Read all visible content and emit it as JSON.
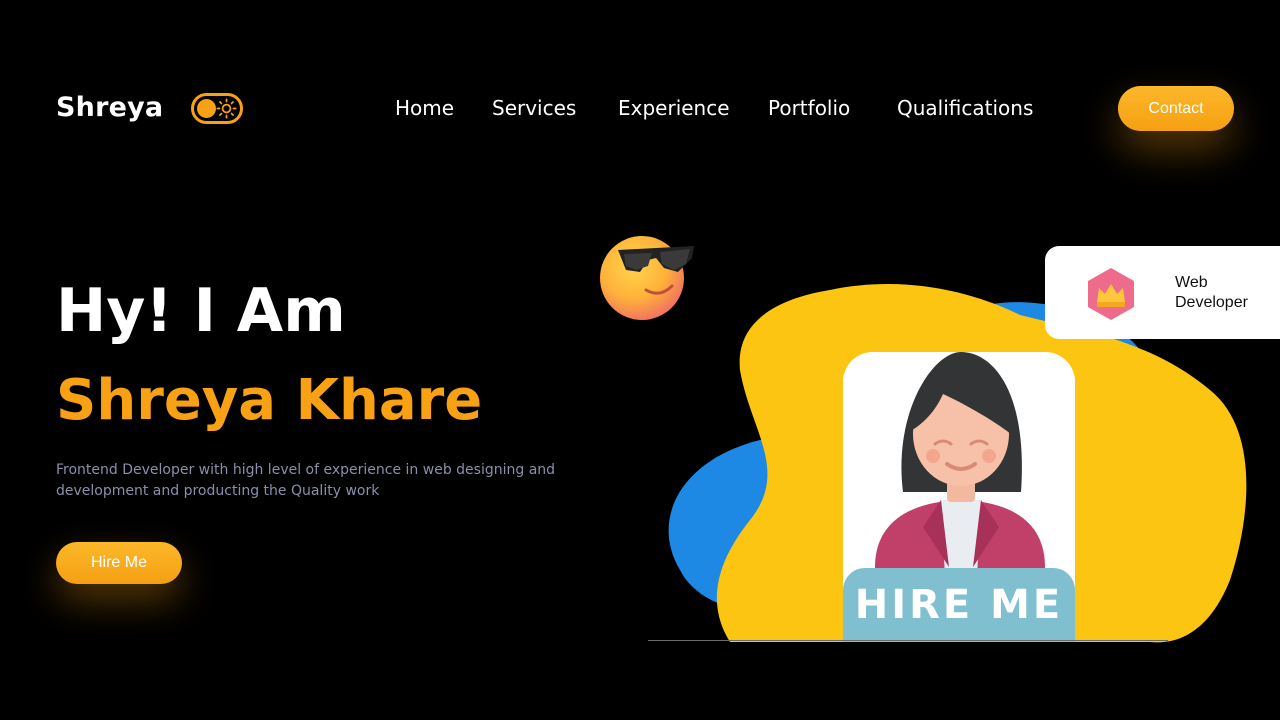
{
  "brand": {
    "name": "Shreya"
  },
  "nav": {
    "items": [
      {
        "label": "Home"
      },
      {
        "label": "Services"
      },
      {
        "label": "Experience"
      },
      {
        "label": "Portfolio"
      },
      {
        "label": "Qualifications"
      }
    ],
    "contact_label": "Contact"
  },
  "theme_toggle": {
    "icon": "sun-icon",
    "state": "dark"
  },
  "hero": {
    "greeting": "Hy! I Am",
    "name": "Shreya Khare",
    "description": "Frontend Developer with high level of experience in web designing and development and producting the Quality work",
    "cta_label": "Hire Me"
  },
  "illustration": {
    "avatar_banner": "HIRE ME",
    "badge": {
      "icon": "crown-icon",
      "line1": "Web",
      "line2": "Developer"
    },
    "emoji": "sunglasses-emoji-icon"
  },
  "colors": {
    "background": "#000000",
    "accent": "#f9a114",
    "blob_yellow": "#fbc512",
    "blob_blue": "#1e88e5",
    "muted_text": "#8b8fab"
  }
}
